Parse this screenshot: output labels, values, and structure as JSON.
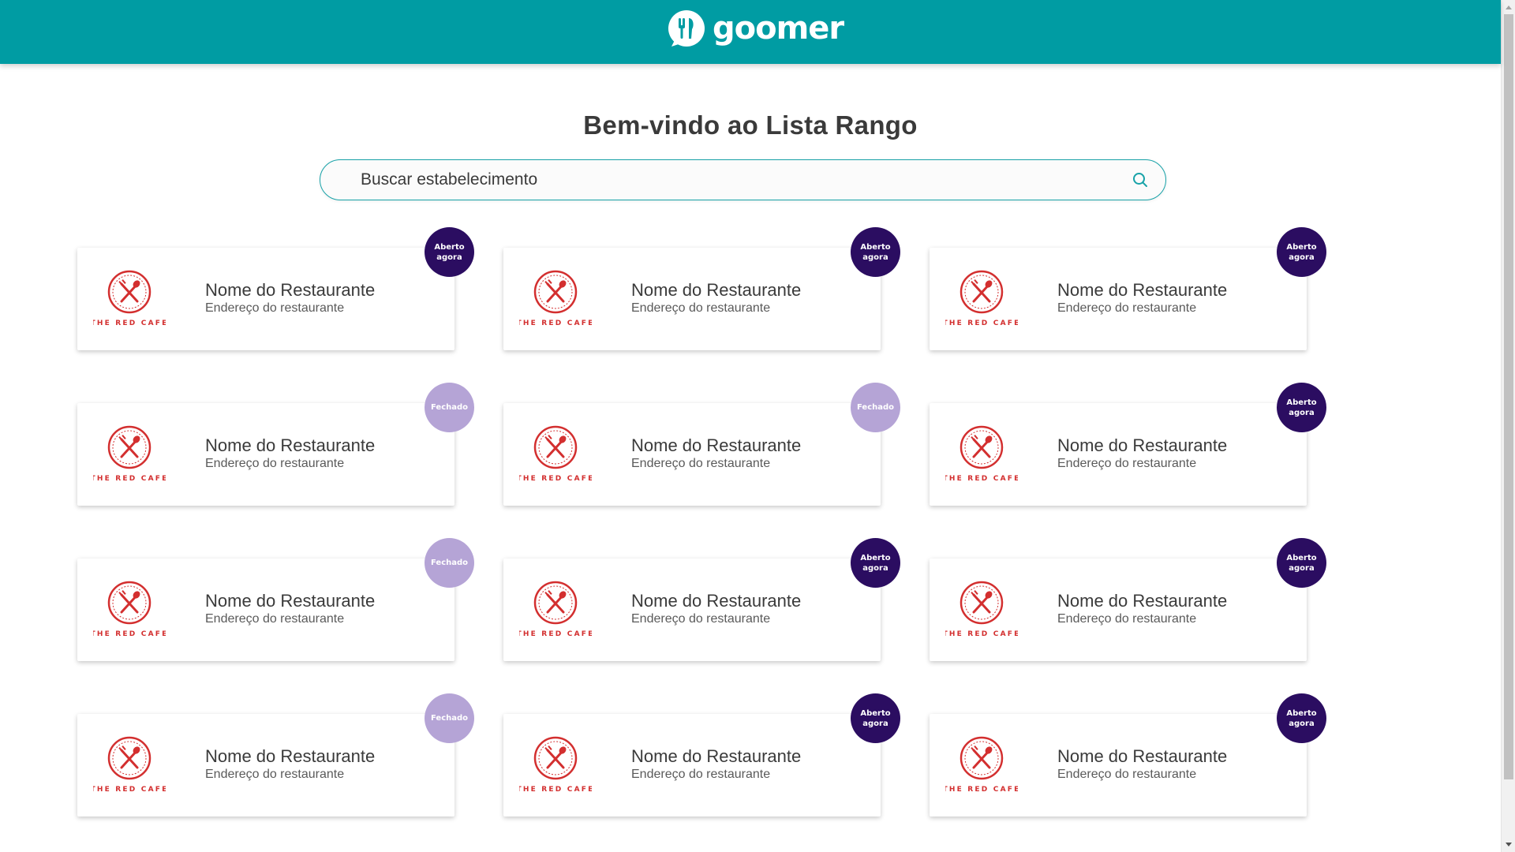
{
  "header": {
    "brand": "goomer"
  },
  "main": {
    "title": "Bem-vindo ao Lista Rango",
    "search": {
      "placeholder": "Buscar estabelecimento",
      "value": ""
    }
  },
  "colors": {
    "header_bg": "#009ca3",
    "open_badge": "#2b0d61",
    "closed_badge": "#b5a4d6",
    "logo_red": "#d32f2f",
    "search_border": "#17a2a8"
  },
  "icons": {
    "brand": "goomer-logo-icon",
    "search": "search-icon",
    "restaurant_logo": "the-red-cafe-logo"
  },
  "restaurants": [
    {
      "name": "Nome do Restaurante",
      "address": "Endereço do restaurante",
      "logo_text": "THE RED CAFE",
      "status": "Aberto agora",
      "open": true
    },
    {
      "name": "Nome do Restaurante",
      "address": "Endereço do restaurante",
      "logo_text": "THE RED CAFE",
      "status": "Aberto agora",
      "open": true
    },
    {
      "name": "Nome do Restaurante",
      "address": "Endereço do restaurante",
      "logo_text": "THE RED CAFE",
      "status": "Aberto agora",
      "open": true
    },
    {
      "name": "Nome do Restaurante",
      "address": "Endereço do restaurante",
      "logo_text": "THE RED CAFE",
      "status": "Fechado",
      "open": false
    },
    {
      "name": "Nome do Restaurante",
      "address": "Endereço do restaurante",
      "logo_text": "THE RED CAFE",
      "status": "Fechado",
      "open": false
    },
    {
      "name": "Nome do Restaurante",
      "address": "Endereço do restaurante",
      "logo_text": "THE RED CAFE",
      "status": "Aberto agora",
      "open": true
    },
    {
      "name": "Nome do Restaurante",
      "address": "Endereço do restaurante",
      "logo_text": "THE RED CAFE",
      "status": "Fechado",
      "open": false
    },
    {
      "name": "Nome do Restaurante",
      "address": "Endereço do restaurante",
      "logo_text": "THE RED CAFE",
      "status": "Aberto agora",
      "open": true
    },
    {
      "name": "Nome do Restaurante",
      "address": "Endereço do restaurante",
      "logo_text": "THE RED CAFE",
      "status": "Aberto agora",
      "open": true
    },
    {
      "name": "Nome do Restaurante",
      "address": "Endereço do restaurante",
      "logo_text": "THE RED CAFE",
      "status": "Fechado",
      "open": false
    },
    {
      "name": "Nome do Restaurante",
      "address": "Endereço do restaurante",
      "logo_text": "THE RED CAFE",
      "status": "Aberto agora",
      "open": true
    },
    {
      "name": "Nome do Restaurante",
      "address": "Endereço do restaurante",
      "logo_text": "THE RED CAFE",
      "status": "Aberto agora",
      "open": true
    }
  ]
}
